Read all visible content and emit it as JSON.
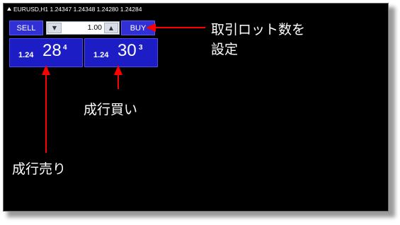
{
  "window": {
    "title": "EURUSD,H1  1.24347 1.24348 1.24280 1.24284"
  },
  "trade_panel": {
    "sell_label": "SELL",
    "buy_label": "BUY",
    "lot_value": "1.00",
    "lot_down_icon": "chevron-down-icon",
    "lot_up_icon": "chevron-up-icon",
    "sell_price": {
      "prefix": "1.24",
      "main": "28",
      "fraction": "4"
    },
    "buy_price": {
      "prefix": "1.24",
      "main": "30",
      "fraction": "3"
    }
  },
  "annotations": {
    "lot_line1": "取引ロット数を",
    "lot_line2": "設定",
    "market_buy": "成行買い",
    "market_sell": "成行売り"
  },
  "colors": {
    "button_blue": "#3030d6",
    "price_blue": "#1d1dc6",
    "arrow_red": "#ff0000",
    "chart_bg": "#000000"
  }
}
